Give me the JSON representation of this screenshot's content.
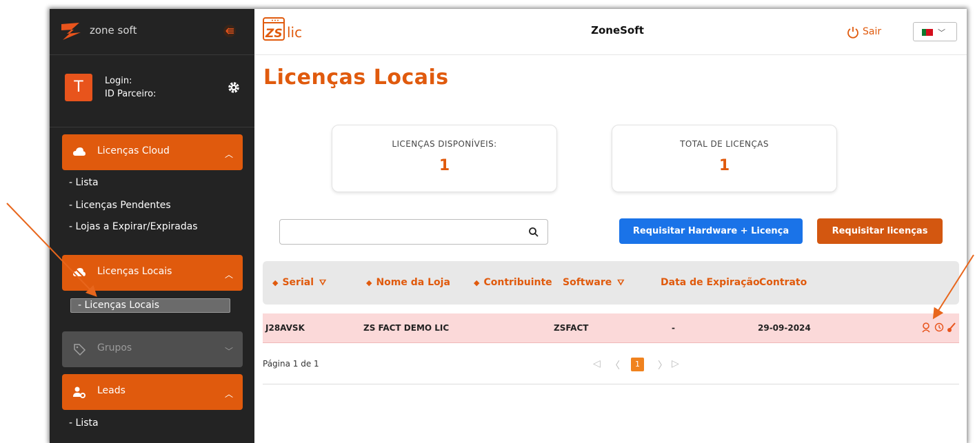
{
  "colors": {
    "accent": "#e05a0d",
    "sidebar_bg": "#232323",
    "primary_button": "#1a73e8",
    "row_highlight": "#fbd9d9"
  },
  "sidebar": {
    "brand": "zone soft",
    "avatar_letter": "T",
    "login_label": "Login:",
    "partner_label": "ID Parceiro:",
    "menus": [
      {
        "label": "Licenças Cloud",
        "items": [
          "Lista",
          "Licenças Pendentes",
          "Lojas a Expirar/Expiradas"
        ]
      },
      {
        "label": "Licenças Locais",
        "items": [
          "Licenças Locais"
        ]
      },
      {
        "label": "Grupos",
        "items": []
      },
      {
        "label": "Leads",
        "items": [
          "Lista"
        ]
      }
    ]
  },
  "topbar": {
    "app_name": "lic",
    "title": "ZoneSoft",
    "logout": "Sair"
  },
  "page": {
    "title": "Licenças Locais",
    "cards": [
      {
        "label": "LICENÇAS DISPONÍVEIS:",
        "value": "1"
      },
      {
        "label": "TOTAL DE LICENÇAS",
        "value": "1"
      }
    ],
    "search": {
      "value": ""
    },
    "buttons": {
      "hardware": "Requisitar Hardware + Licença",
      "licenses": "Requisitar licenças"
    }
  },
  "table": {
    "columns": [
      "Serial",
      "Nome da Loja",
      "Contribuinte",
      "Software",
      "Data de Expiração",
      "Contrato"
    ],
    "rows": [
      {
        "serial": "J28AVSK",
        "store": "ZS FACT DEMO LIC",
        "taxpayer": "",
        "software": "ZSFACT",
        "expiry": "-",
        "contract": "29-09-2024"
      }
    ],
    "pagination": {
      "text": "Página 1 de 1",
      "current": "1"
    }
  }
}
